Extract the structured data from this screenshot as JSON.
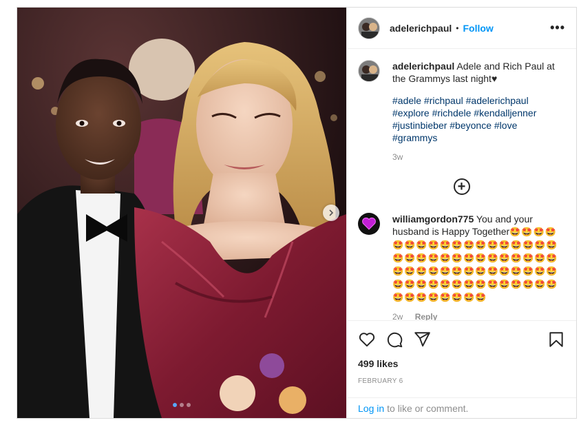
{
  "post": {
    "username": "adelerichpaul",
    "follow_label": "Follow",
    "separator": "•",
    "more_label": "•••",
    "caption": {
      "username": "adelerichpaul",
      "text": "Adele and Rich Paul at the Grammys last night♥",
      "hashtags": "#adele #richpaul #adelerichpaul #explore #richdele #kendalljenner #justinbieber #beyonce #love #grammys",
      "time": "3w"
    },
    "load_more_icon": "plus-circle-icon",
    "comments": [
      {
        "username": "williamgordon775",
        "text": "You and your husband is Happy Together",
        "emoji": "🤩🤩🤩🤩🤩🤩🤩🤩🤩🤩🤩🤩🤩🤩🤩🤩🤩🤩🤩🤩🤩🤩🤩🤩🤩🤩🤩🤩🤩🤩🤩🤩🤩🤩🤩🤩🤩🤩🤩🤩🤩🤩🤩🤩🤩🤩🤩🤩🤩🤩🤩🤩🤩🤩🤩🤩🤩🤩🤩🤩🤩🤩🤩🤩🤩🤩🤩🤩",
        "time": "2w",
        "reply_label": "Reply"
      }
    ],
    "likes": "499 likes",
    "date": "FEBRUARY 6",
    "login": {
      "link": "Log in",
      "text": "to like or comment."
    },
    "carousel": {
      "count": 3,
      "active": 0
    },
    "colors": {
      "accent": "#0095f6",
      "hashtag": "#00376b",
      "muted": "#8e8e8e"
    }
  }
}
